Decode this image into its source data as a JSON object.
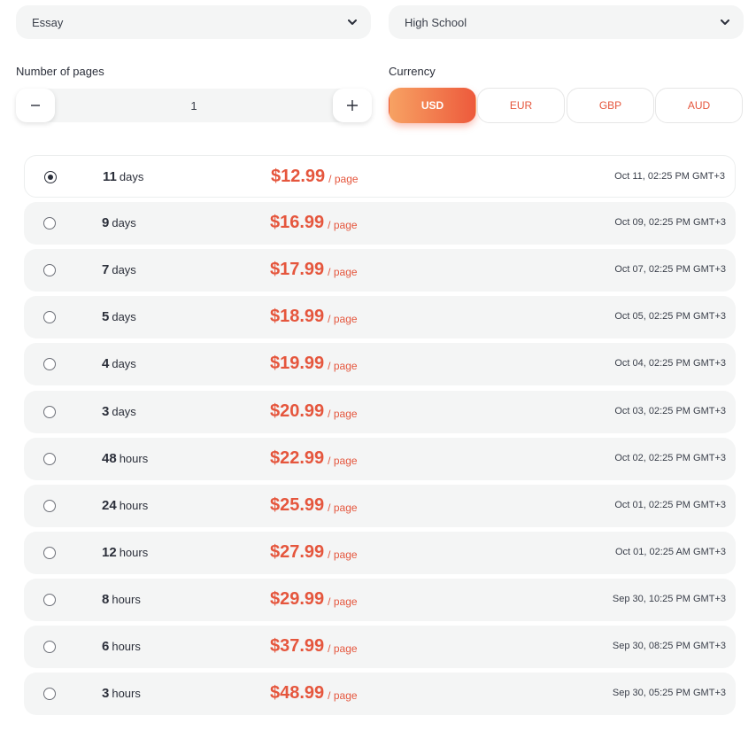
{
  "selects": {
    "paper_type": "Essay",
    "academic_level": "High School"
  },
  "pages": {
    "label": "Number of pages",
    "value": "1",
    "minus": "−",
    "plus": "+"
  },
  "currency": {
    "label": "Currency",
    "options": [
      "USD",
      "EUR",
      "GBP",
      "AUD"
    ],
    "selected": "USD"
  },
  "colors": {
    "accent": "#e5563d",
    "gradient_start": "#f7a263",
    "gradient_end": "#ed5a3c",
    "row_bg": "#f4f5f5"
  },
  "per_page_label": "/ page",
  "deadlines": [
    {
      "num": "11",
      "unit": "days",
      "price": "$12.99",
      "date": "Oct 11, 02:25 PM GMT+3",
      "selected": true
    },
    {
      "num": "9",
      "unit": "days",
      "price": "$16.99",
      "date": "Oct 09, 02:25 PM GMT+3",
      "selected": false
    },
    {
      "num": "7",
      "unit": "days",
      "price": "$17.99",
      "date": "Oct 07, 02:25 PM GMT+3",
      "selected": false
    },
    {
      "num": "5",
      "unit": "days",
      "price": "$18.99",
      "date": "Oct 05, 02:25 PM GMT+3",
      "selected": false
    },
    {
      "num": "4",
      "unit": "days",
      "price": "$19.99",
      "date": "Oct 04, 02:25 PM GMT+3",
      "selected": false
    },
    {
      "num": "3",
      "unit": "days",
      "price": "$20.99",
      "date": "Oct 03, 02:25 PM GMT+3",
      "selected": false
    },
    {
      "num": "48",
      "unit": "hours",
      "price": "$22.99",
      "date": "Oct 02, 02:25 PM GMT+3",
      "selected": false
    },
    {
      "num": "24",
      "unit": "hours",
      "price": "$25.99",
      "date": "Oct 01, 02:25 PM GMT+3",
      "selected": false
    },
    {
      "num": "12",
      "unit": "hours",
      "price": "$27.99",
      "date": "Oct 01, 02:25 AM GMT+3",
      "selected": false
    },
    {
      "num": "8",
      "unit": "hours",
      "price": "$29.99",
      "date": "Sep 30, 10:25 PM GMT+3",
      "selected": false
    },
    {
      "num": "6",
      "unit": "hours",
      "price": "$37.99",
      "date": "Sep 30, 08:25 PM GMT+3",
      "selected": false
    },
    {
      "num": "3",
      "unit": "hours",
      "price": "$48.99",
      "date": "Sep 30, 05:25 PM GMT+3",
      "selected": false
    }
  ]
}
